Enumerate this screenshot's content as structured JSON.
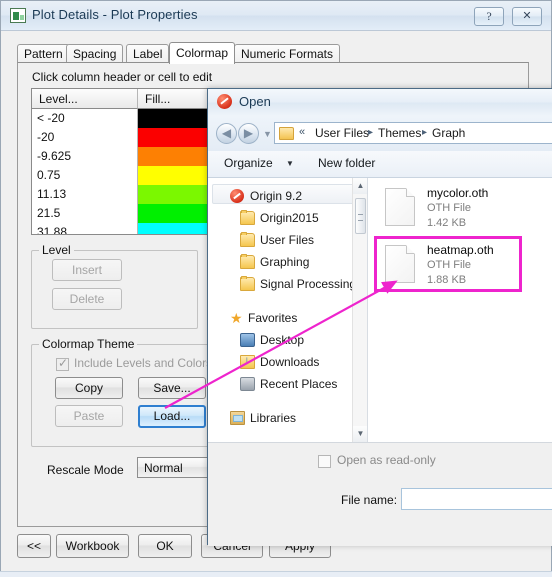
{
  "plot_window": {
    "title": "Plot Details - Plot Properties",
    "titlebar_icon": "plot-window-icon",
    "help_glyph": "?",
    "close_glyph": "✕",
    "tabs": [
      {
        "label": "Pattern",
        "active": false
      },
      {
        "label": "Spacing",
        "active": false
      },
      {
        "label": "Label",
        "active": false
      },
      {
        "label": "Colormap",
        "active": true
      },
      {
        "label": "Numeric Formats",
        "active": false
      }
    ],
    "hint": "Click column header or cell to edit",
    "grid": {
      "headers": [
        "Level...",
        "Fill...",
        ""
      ],
      "rows": [
        {
          "level": "< -20",
          "fill": "#000000"
        },
        {
          "level": "-20",
          "fill": "#fb0000"
        },
        {
          "level": "-9.625",
          "fill": "#fd8003"
        },
        {
          "level": "0.75",
          "fill": "#ffff00"
        },
        {
          "level": "11.13",
          "fill": "#7bf800"
        },
        {
          "level": "21.5",
          "fill": "#00f000"
        },
        {
          "level": "31.88",
          "fill": "#00ffff"
        }
      ]
    },
    "level_group": {
      "label": "Level",
      "insert_label": "Insert",
      "delete_label": "Delete"
    },
    "theme_group": {
      "label": "Colormap Theme",
      "include_checkbox_label": "Include Levels and Colors Only",
      "include_checked": true,
      "copy_label": "Copy",
      "save_label": "Save...",
      "paste_label": "Paste",
      "load_label": "Load...",
      "load_highlight_color": "#2f7fd0"
    },
    "rescale": {
      "label": "Rescale Mode",
      "value": "Normal"
    },
    "footer_buttons": {
      "back_label": "<<",
      "workbook_label": "Workbook",
      "ok_label": "OK",
      "cancel_label": "Cancel",
      "apply_label": "Apply"
    }
  },
  "open_dialog": {
    "title": "Open",
    "titlebar_icon": "origin-app-icon",
    "address": {
      "folder_icon": "folder-icon",
      "overflow_chevron": "«",
      "crumbs": [
        "User Files",
        "Themes",
        "Graph"
      ],
      "separator": "▸"
    },
    "toolbar": {
      "organize_label": "Organize",
      "organize_caret": "▼",
      "new_folder_label": "New folder"
    },
    "nav_pane": {
      "items": [
        {
          "label": "Origin 9.2",
          "icon": "origin-app-icon",
          "indent": 22,
          "selected": true
        },
        {
          "label": "Origin2015",
          "icon": "folder-icon",
          "indent": 32,
          "selected": false
        },
        {
          "label": "User Files",
          "icon": "folder-icon",
          "indent": 32,
          "selected": false
        },
        {
          "label": "Graphing",
          "icon": "folder-icon",
          "indent": 32,
          "selected": false
        },
        {
          "label": "Signal Processing",
          "icon": "folder-icon",
          "indent": 32,
          "selected": false
        },
        {
          "label": "Favorites",
          "icon": "star-icon",
          "indent": 22,
          "selected": false
        },
        {
          "label": "Desktop",
          "icon": "desktop-icon",
          "indent": 32,
          "selected": false
        },
        {
          "label": "Downloads",
          "icon": "downloads-icon",
          "indent": 32,
          "selected": false
        },
        {
          "label": "Recent Places",
          "icon": "recent-icon",
          "indent": 32,
          "selected": false
        },
        {
          "label": "Libraries",
          "icon": "library-icon",
          "indent": 22,
          "selected": false
        }
      ],
      "scroll_up_glyph": "▲",
      "scroll_down_glyph": "▼"
    },
    "files": [
      {
        "name": "mycolor.oth",
        "type": "OTH File",
        "size": "1.42 KB",
        "highlighted": false
      },
      {
        "name": "heatmap.oth",
        "type": "OTH File",
        "size": "1.88 KB",
        "highlighted": true
      }
    ],
    "highlight_color": "#ee24cd",
    "footer": {
      "readonly_label": "Open as read-only",
      "readonly_checked": false,
      "filename_label": "File name:",
      "filename_value": "",
      "filename_placeholder": ""
    }
  },
  "annotation": {
    "arrow_color": "#ee24cd",
    "description": "arrow from Load button to heatmap.oth file"
  }
}
